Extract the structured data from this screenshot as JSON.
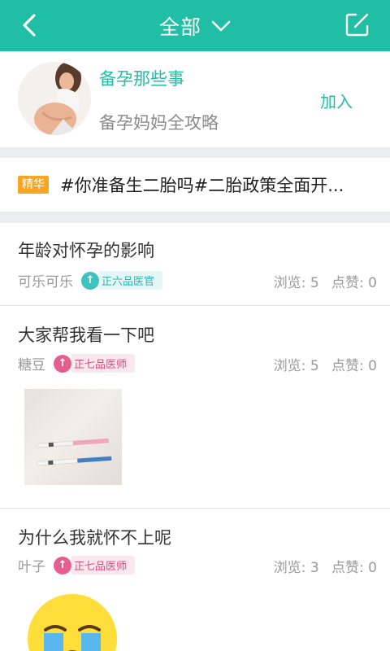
{
  "header": {
    "title": "全部"
  },
  "group": {
    "name": "备孕那些事",
    "description": "备孕妈妈全攻略",
    "join_label": "加入"
  },
  "featured": {
    "badge": "精华",
    "text": "#你准备生二胎吗#二胎政策全面开..."
  },
  "posts": [
    {
      "title": "年龄对怀孕的影响",
      "author": "可乐可乐",
      "rank": "正六品医官",
      "views": "浏览: 5",
      "likes": "点赞: 0"
    },
    {
      "title": "大家帮我看一下吧",
      "author": "糖豆",
      "rank": "正七品医师",
      "views": "浏览: 5",
      "likes": "点赞: 0"
    },
    {
      "title": "为什么我就怀不上呢",
      "author": "叶子",
      "rank": "正七品医师",
      "views": "浏览: 3",
      "likes": "点赞: 0"
    }
  ],
  "colors": {
    "primary": "#1fbea5",
    "badge": "#f6a623"
  }
}
